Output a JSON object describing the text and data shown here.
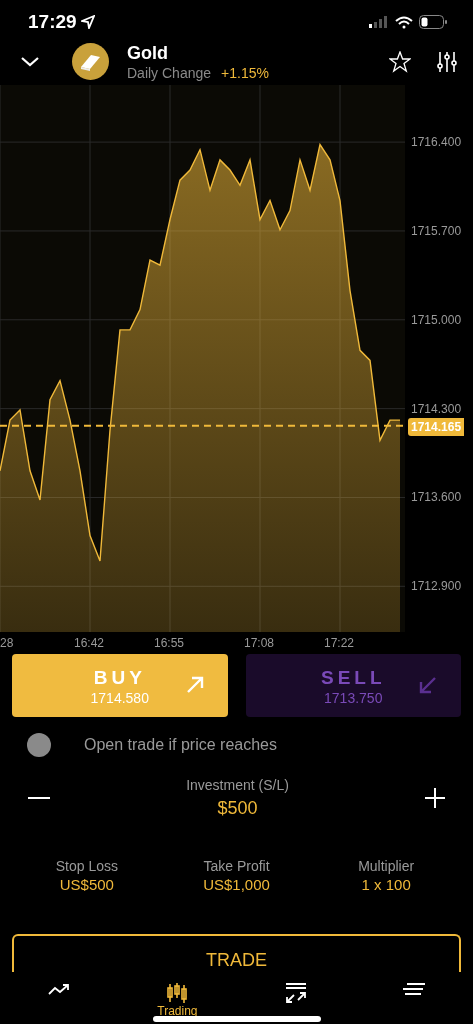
{
  "status_bar": {
    "time": "17:29"
  },
  "header": {
    "title": "Gold",
    "subtitle": "Daily Change",
    "change": "+1.15%",
    "favorite": false
  },
  "chart": {
    "chart_data": {
      "type": "area",
      "categories": [
        "28",
        null,
        null,
        null,
        null,
        null,
        null,
        null,
        null,
        "16:42",
        null,
        null,
        null,
        null,
        null,
        null,
        null,
        "16:55",
        null,
        null,
        null,
        null,
        null,
        null,
        null,
        null,
        "17:08",
        null,
        null,
        null,
        null,
        null,
        null,
        null,
        "17:22",
        null,
        null,
        null,
        null,
        null,
        null
      ],
      "series": [
        {
          "color": "#f0b93a",
          "values": [
            1713.81,
            1714.21,
            1714.29,
            1713.81,
            1713.58,
            1714.37,
            1714.52,
            1714.21,
            1713.81,
            1713.3,
            1713.1,
            1714.13,
            1714.92,
            1714.92,
            1715.08,
            1715.47,
            1715.43,
            1715.79,
            1716.1,
            1716.18,
            1716.34,
            1716.02,
            1716.26,
            1716.18,
            1716.06,
            1716.26,
            1715.79,
            1715.94,
            1715.71,
            1715.86,
            1716.26,
            1716.02,
            1716.38,
            1716.26,
            1715.94,
            1715.23,
            1714.76,
            1714.68,
            1714.05,
            1714.21,
            1714.21
          ]
        }
      ],
      "ylim": [
        1712.54,
        1716.85
      ],
      "yticks": [
        {
          "value": 1716.4,
          "label": "1716.400"
        },
        {
          "value": 1715.7,
          "label": "1715.700"
        },
        {
          "value": 1715.0,
          "label": "1715.000"
        },
        {
          "value": 1714.3,
          "label": "1714.300"
        },
        {
          "value": 1713.6,
          "label": "1713.600"
        },
        {
          "value": 1712.9,
          "label": "1712.900"
        }
      ],
      "grid": true,
      "ref_lines": [
        {
          "axis": "y",
          "value": 1714.165,
          "label": "1714.165"
        }
      ]
    }
  },
  "actions": [
    {
      "kind": "buy",
      "label": "BUY",
      "price": "1714.580",
      "disabled": false
    },
    {
      "kind": "sell",
      "label": "SELL",
      "price": "1713.750",
      "disabled": true
    }
  ],
  "limit_toggle": {
    "label": "Open trade if price reaches",
    "on": false
  },
  "investment": {
    "label": "Investment (S/L)",
    "value": "$500"
  },
  "stats": [
    {
      "label": "Stop Loss",
      "value": "US$500"
    },
    {
      "label": "Take Profit",
      "value": "US$1,000"
    },
    {
      "label": "Multiplier",
      "value": "1 x 100"
    }
  ],
  "trade_button": {
    "label": "TRADE"
  },
  "tabs": [
    {
      "kind": "trend",
      "selected": false
    },
    {
      "kind": "candles",
      "label": "Trading",
      "selected": true
    },
    {
      "kind": "transfer",
      "selected": false
    },
    {
      "kind": "lines",
      "selected": false
    }
  ]
}
